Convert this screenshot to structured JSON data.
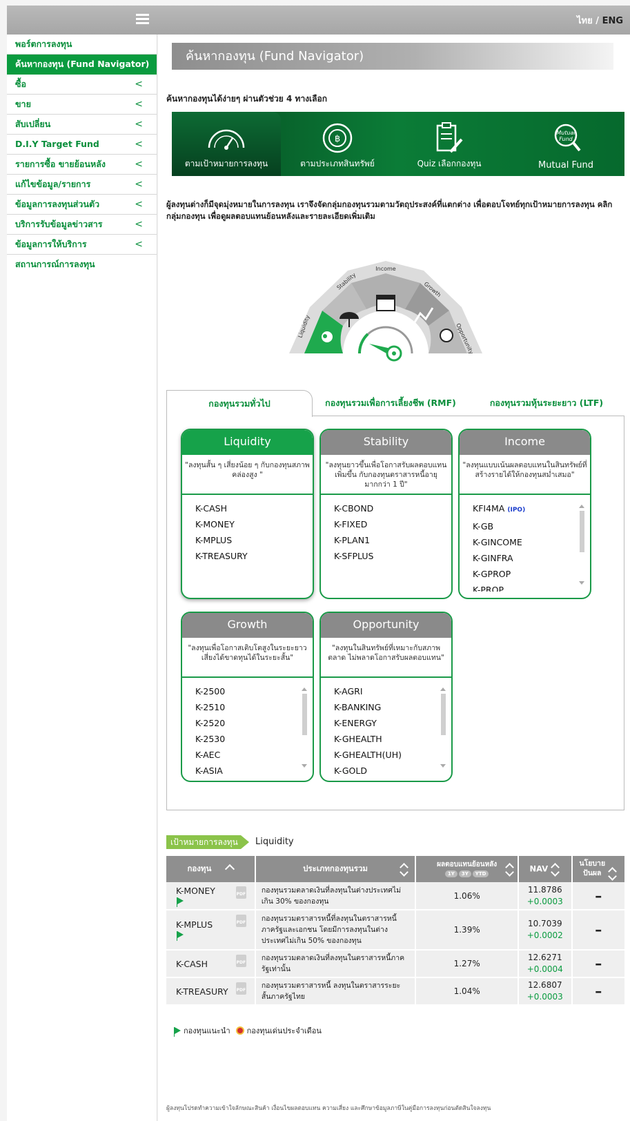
{
  "header": {
    "lang_th": "ไทย",
    "lang_sep": " / ",
    "lang_en": "ENG"
  },
  "sidebar": {
    "items": [
      {
        "label": "พอร์ตการลงทุน",
        "chevron": false
      },
      {
        "label": "ค้นหากองทุน (Fund Navigator)",
        "chevron": false,
        "active": true
      },
      {
        "label": "ซื้อ",
        "chevron": true
      },
      {
        "label": "ขาย",
        "chevron": true
      },
      {
        "label": "สับเปลี่ยน",
        "chevron": true
      },
      {
        "label": "D.I.Y Target Fund",
        "chevron": true
      },
      {
        "label": "รายการซื้อ ขายย้อนหลัง",
        "chevron": true
      },
      {
        "label": "แก้ไขข้อมูล/รายการ",
        "chevron": true
      },
      {
        "label": "ข้อมูลการลงทุนส่วนตัว",
        "chevron": true
      },
      {
        "label": "บริการรับข้อมูลข่าวสาร",
        "chevron": true
      },
      {
        "label": "ข้อมูลการให้บริการ",
        "chevron": true
      },
      {
        "label": "สถานการณ์การลงทุน",
        "chevron": false
      }
    ],
    "chevron_glyph": "<"
  },
  "main": {
    "title": "ค้นหากองทุน (Fund Navigator)",
    "intro": "ค้นหากองทุนได้ง่ายๆ ผ่านตัวช่วย 4 ทางเลือก",
    "nav_tabs": [
      {
        "label": "ตามเป้าหมายการลงทุน",
        "icon": "gauge-icon"
      },
      {
        "label": "ตามประเภทสินทรัพย์",
        "icon": "target-money-icon"
      },
      {
        "label": "Quiz เลือกกองทุน",
        "icon": "clipboard-pen-icon"
      },
      {
        "label": "Mutual Fund",
        "icon": "mutual-fund-icon"
      }
    ],
    "description": "ผู้ลงทุนต่างก็มีจุดมุ่งหมายในการลงทุน เราจึงจัดกลุ่มกองทุนรวมตามวัตถุประสงค์ที่แตกต่าง เพื่อตอบโจทย์ทุกเป้าหมายการลงทุน คลิกกลุ่มกองทุน เพื่อดูผลตอบแทนย้อนหลังและรายละเอียดเพิ่มเติม",
    "wheel": {
      "labels": [
        "Liquidity",
        "Stability",
        "Income",
        "Growth",
        "Opportunity"
      ],
      "selected": "Liquidity"
    },
    "fund_tabs": [
      "กองทุนรวมทั่วไป",
      "กองทุนรวมเพื่อการเลี้ยงชีพ (RMF)",
      "กองทุนรวมหุ้นระยะยาว (LTF)"
    ],
    "cards": [
      {
        "title": "Liquidity",
        "desc": "\"ลงทุนสั้น ๆ เสี่ยงน้อย ๆ กับกองทุนสภาพคล่องสูง \"",
        "funds": [
          "K-CASH",
          "K-MONEY",
          "K-MPLUS",
          "K-TREASURY"
        ]
      },
      {
        "title": "Stability",
        "desc": "\"ลงทุนยาวขึ้นเพื่อโอกาสรับผลตอบแทนเพิ่มขึ้น กับกองทุนตราสารหนี้อายุมากกว่า 1 ปี\"",
        "funds": [
          "K-CBOND",
          "K-FIXED",
          "K-PLAN1",
          "K-SFPLUS"
        ]
      },
      {
        "title": "Income",
        "desc": "\"ลงทุนแบบเน้นผลตอบแทนในสินทรัพย์ที่สร้างรายได้ให้กองทุนสม่ำเสมอ\"",
        "funds": [
          "KFI4MA",
          "K-GB",
          "K-GINCOME",
          "K-GINFRA",
          "K-GPROP",
          "K-PROP"
        ],
        "ipo_tag": "(IPO)"
      },
      {
        "title": "Growth",
        "desc": "\"ลงทุนเพื่อโอกาสเติบโตสูงในระยะยาว เสี่ยงได้ขาดทุนได้ในระยะสั้น\"",
        "funds": [
          "K-2500",
          "K-2510",
          "K-2520",
          "K-2530",
          "K-AEC",
          "K-ASIA"
        ]
      },
      {
        "title": "Opportunity",
        "desc": "\"ลงทุนในสินทรัพย์ที่เหมาะกับสภาพตลาด ไม่พลาดโอกาสรับผลตอบแทน\"",
        "funds": [
          "K-AGRI",
          "K-BANKING",
          "K-ENERGY",
          "K-GHEALTH",
          "K-GHEALTH(UH)",
          "K-GOLD"
        ]
      }
    ],
    "goal": {
      "label": "เป้าหมายการลงทุน",
      "value": "Liquidity"
    },
    "table": {
      "headers": {
        "fund": "กองทุน",
        "type": "ประเภทกองทุนรวม",
        "return": "ผลตอบแทนย้อนหลัง",
        "periods": [
          "1Y",
          "3Y",
          "YTD"
        ],
        "nav": "NAV",
        "dividend": "นโยบาย ปันผล"
      },
      "rows": [
        {
          "fund": "K-MONEY",
          "type": "กองทุนรวมตลาดเงินที่ลงทุนในต่างประเทศไม่เกิน 30% ของกองทุน",
          "return": "1.06%",
          "nav": "11.8786",
          "change": "+0.0003",
          "dividend": "–",
          "flag": true
        },
        {
          "fund": "K-MPLUS",
          "type": "กองทุนรวมตราสารหนี้ที่ลงทุนในตราสารหนี้ภาครัฐและเอกชน โดยมีการลงทุนในต่างประเทศไม่เกิน 50% ของกองทุน",
          "return": "1.39%",
          "nav": "10.7039",
          "change": "+0.0002",
          "dividend": "–",
          "flag": true
        },
        {
          "fund": "K-CASH",
          "type": "กองทุนรวมตลาดเงินที่ลงทุนในตราสารหนี้ภาครัฐเท่านั้น",
          "return": "1.27%",
          "nav": "12.6271",
          "change": "+0.0004",
          "dividend": "–",
          "flag": false
        },
        {
          "fund": "K-TREASURY",
          "type": "กองทุนรวมตราสารหนี้ ลงทุนในตราสารระยะสั้นภาครัฐไทย",
          "return": "1.04%",
          "nav": "12.6807",
          "change": "+0.0003",
          "dividend": "–",
          "flag": false
        }
      ],
      "pdf_label": "PDF"
    },
    "legend": {
      "recommended": "กองทุนแนะนำ",
      "monthly": "กองทุนเด่นประจำเดือน"
    },
    "footnote": "ผู้ลงทุนโปรดทำความเข้าใจลักษณะสินค้า เงื่อนไขผลตอบแทน ความเสี่ยง และศึกษาข้อมูลภาษีในคู่มือการลงทุนก่อนตัดสินใจลงทุน"
  },
  "colors": {
    "brand_green": "#0a9b3f",
    "header_gray": "#a6a6a6",
    "card_gray": "#8a8a8a"
  }
}
